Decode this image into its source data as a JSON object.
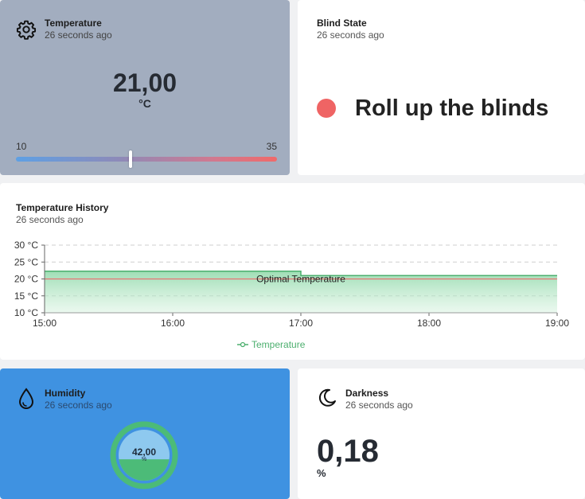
{
  "temperature_card": {
    "title": "Temperature",
    "updated": "26 seconds ago",
    "value": "21,00",
    "unit": "°C",
    "slider_min": "10",
    "slider_max": "35",
    "slider_position": 0.44,
    "icon": "gear-icon",
    "background": "#a2adbf"
  },
  "blind_card": {
    "title": "Blind State",
    "updated": "26 seconds ago",
    "status_text": "Roll up the blinds",
    "status_color": "#ef6464"
  },
  "history_card": {
    "title": "Temperature History",
    "updated": "26 seconds ago"
  },
  "chart_data": {
    "type": "area",
    "x": [
      "15:00",
      "16:00",
      "17:00",
      "18:00",
      "19:00"
    ],
    "y_ticks": [
      "10 °C",
      "15 °C",
      "20 °C",
      "25 °C",
      "30 °C"
    ],
    "ylim": [
      10,
      30
    ],
    "series": [
      {
        "name": "Temperature",
        "color": "#4caf6e",
        "points": [
          {
            "x": "15:00",
            "y": 22.3
          },
          {
            "x": "17:00",
            "y": 22.3
          },
          {
            "x": "17:00",
            "y": 21.0
          },
          {
            "x": "19:00",
            "y": 21.0
          }
        ]
      }
    ],
    "threshold": {
      "label": "Optimal Temperature",
      "y": 20,
      "color": "#e57373"
    },
    "grid": true,
    "legend_position": "bottom-center"
  },
  "humidity_card": {
    "title": "Humidity",
    "updated": "26 seconds ago",
    "value": "42,00",
    "unit": "%",
    "fill_fraction": 0.42,
    "icon": "water-drop-icon",
    "background": "#3f92e1",
    "gauge_color": "#4cbb78"
  },
  "darkness_card": {
    "title": "Darkness",
    "updated": "26 seconds ago",
    "value": "0,18",
    "unit": "%",
    "icon": "moon-icon"
  }
}
